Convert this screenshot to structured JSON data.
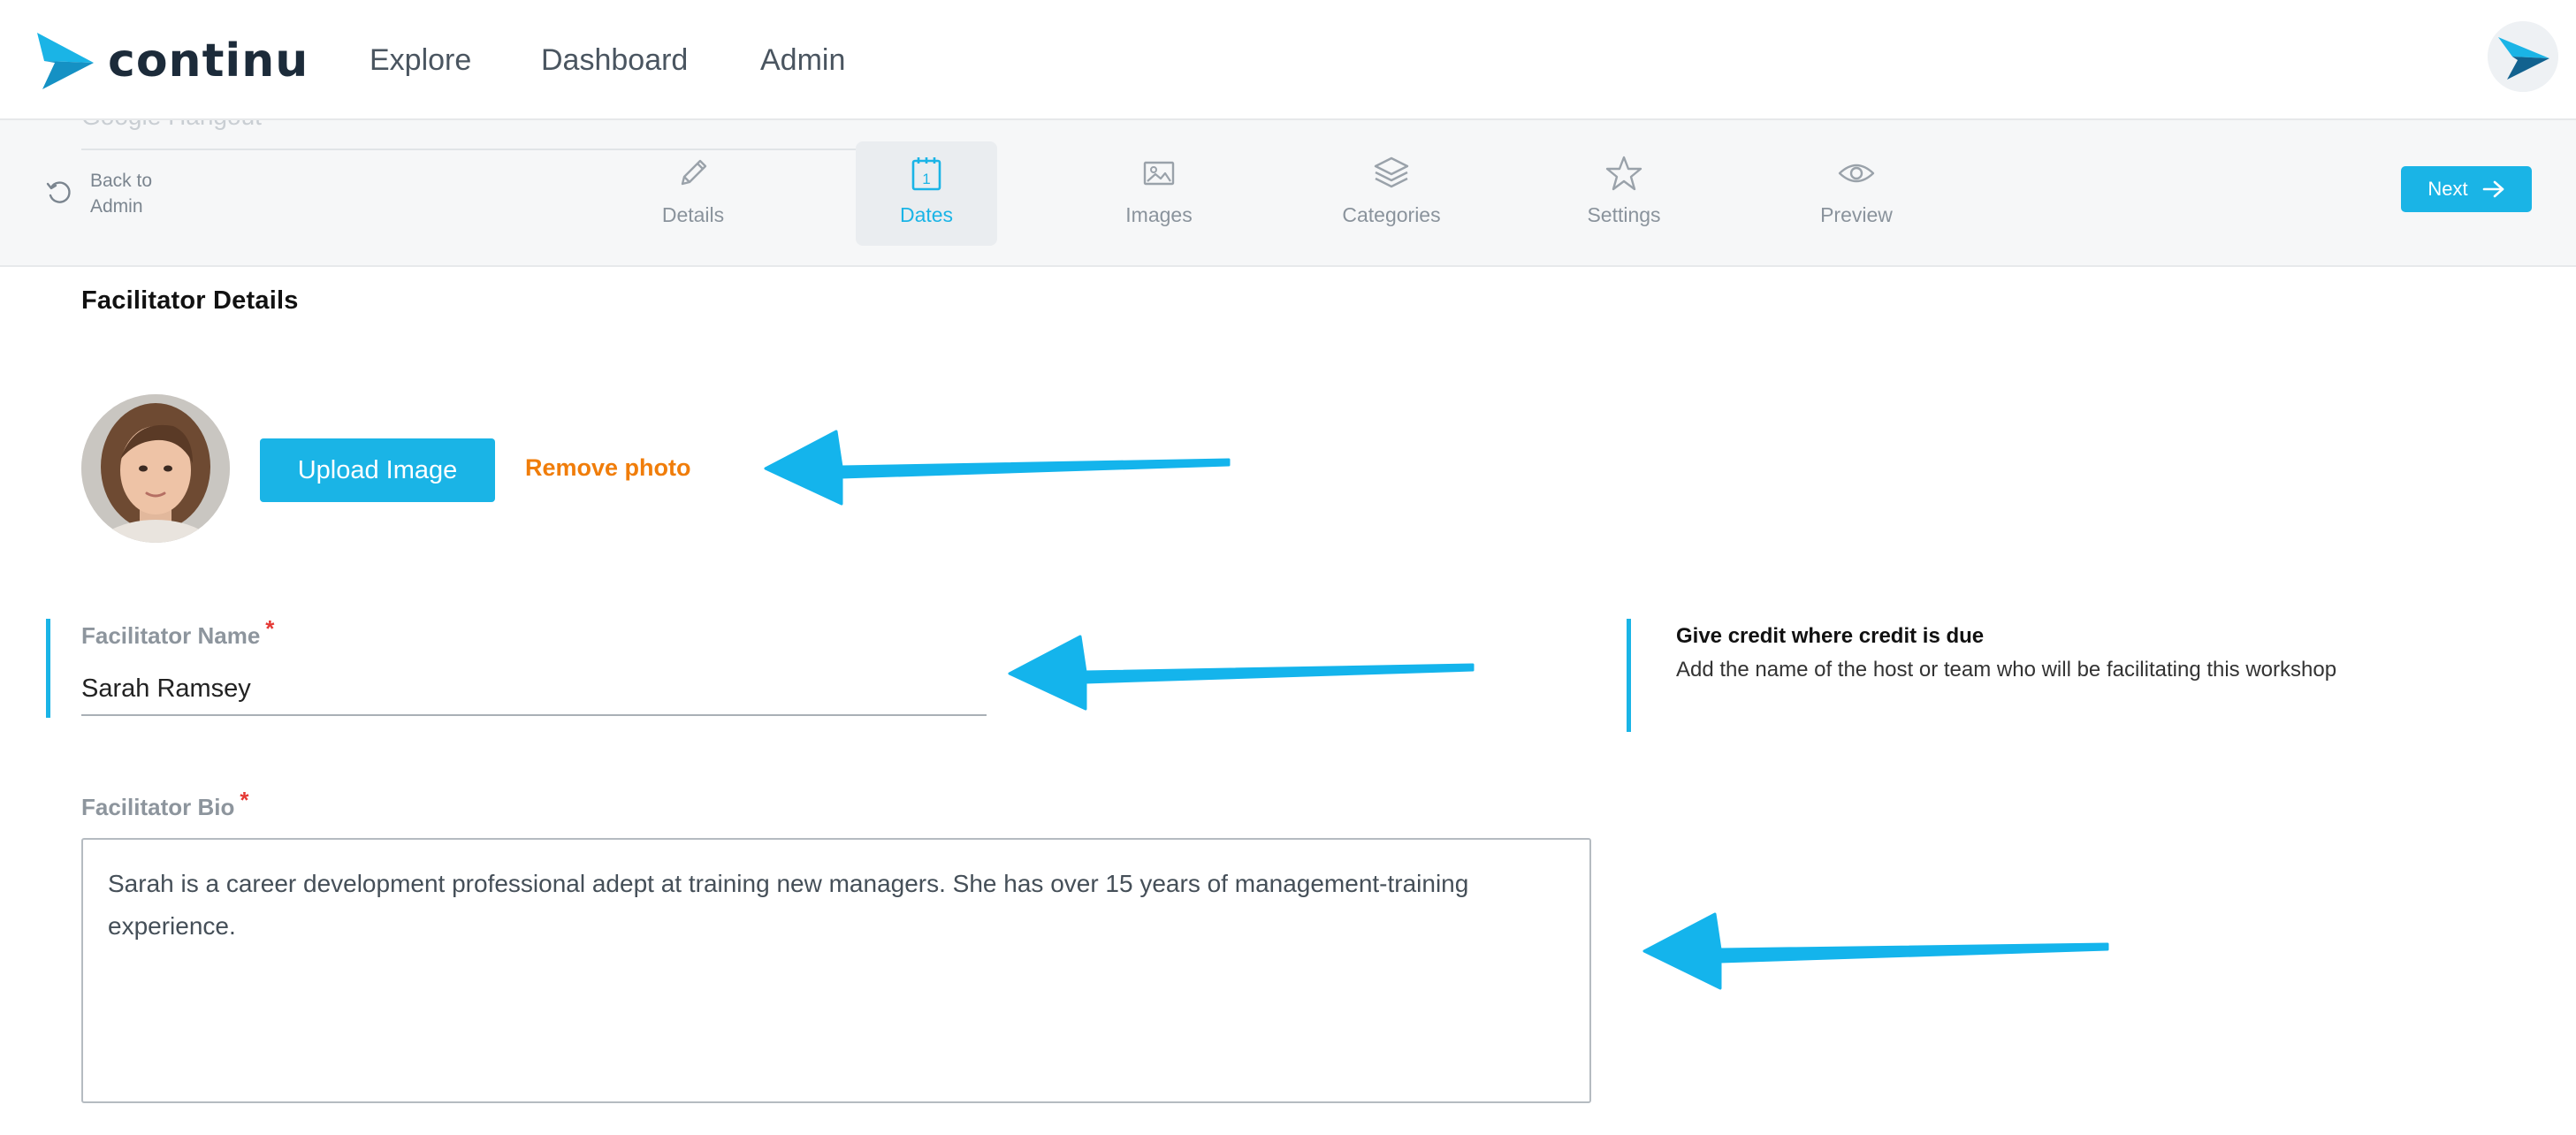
{
  "brand": {
    "name": "continu",
    "accent": "#1ab4e6",
    "dark": "#1c2b3a"
  },
  "nav": {
    "links": [
      "Explore",
      "Dashboard",
      "Admin"
    ]
  },
  "stepbar": {
    "ghost_value": "Google Hangout",
    "back_label": "Back to Admin",
    "steps": [
      {
        "label": "Details",
        "icon": "pencil-icon",
        "active": false
      },
      {
        "label": "Dates",
        "icon": "calendar-icon",
        "active": true
      },
      {
        "label": "Images",
        "icon": "image-icon",
        "active": false
      },
      {
        "label": "Categories",
        "icon": "layers-icon",
        "active": false
      },
      {
        "label": "Settings",
        "icon": "star-icon",
        "active": false
      },
      {
        "label": "Preview",
        "icon": "eye-icon",
        "active": false
      }
    ],
    "calendar_day": "1",
    "next_label": "Next"
  },
  "facilitator": {
    "section_title": "Facilitator Details",
    "upload_label": "Upload Image",
    "remove_label": "Remove photo",
    "name_label": "Facilitator Name",
    "name_value": "Sarah Ramsey",
    "required_mark": "*",
    "hint_title": "Give credit where credit is due",
    "hint_text": "Add the name of the host or team who will be facilitating this workshop",
    "bio_label": "Facilitator Bio",
    "bio_value": "Sarah is a career development professional adept at training new managers. She has over 15 years of management-training experience."
  },
  "annotations": {
    "arrow_color": "#14b4ec"
  }
}
